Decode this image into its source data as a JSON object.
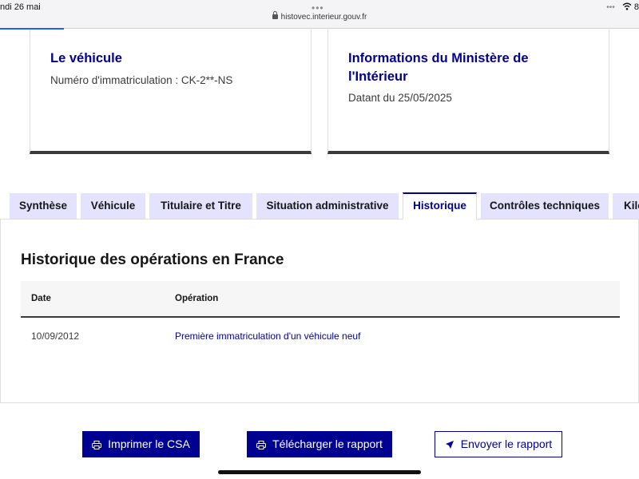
{
  "status_bar": {
    "date": "ndi 26 mai",
    "tab_dots": "•••",
    "url": "histovec.interieur.gouv.fr",
    "right_dots": "•••",
    "battery_text": "8"
  },
  "vehicle_card": {
    "title": "Le véhicule",
    "plate_text": "Numéro d'immatriculation : CK-2**-NS"
  },
  "ministry_card": {
    "title_line1": "Informations du Ministère de",
    "title_line2": "l'Intérieur",
    "date_text": "Datant du 25/05/2025"
  },
  "tabs": [
    {
      "label": "Synthèse",
      "active": false
    },
    {
      "label": "Véhicule",
      "active": false
    },
    {
      "label": "Titulaire et Titre",
      "active": false
    },
    {
      "label": "Situation administrative",
      "active": false
    },
    {
      "label": "Historique",
      "active": true
    },
    {
      "label": "Contrôles techniques",
      "active": false
    },
    {
      "label": "Kilo",
      "active": false
    }
  ],
  "history": {
    "title": "Historique des opérations en France",
    "columns": [
      "Date",
      "Opération"
    ],
    "rows": [
      {
        "date": "10/09/2012",
        "operation": "Première immatriculation d'un véhicule neuf"
      }
    ]
  },
  "actions": {
    "print_label": "Imprimer le CSA",
    "download_label": "Télécharger le rapport",
    "send_label": "Envoyer le rapport"
  },
  "colors": {
    "primary_blue": "#000091",
    "tab_background": "#e3e3fd",
    "text_dark": "#161616"
  }
}
